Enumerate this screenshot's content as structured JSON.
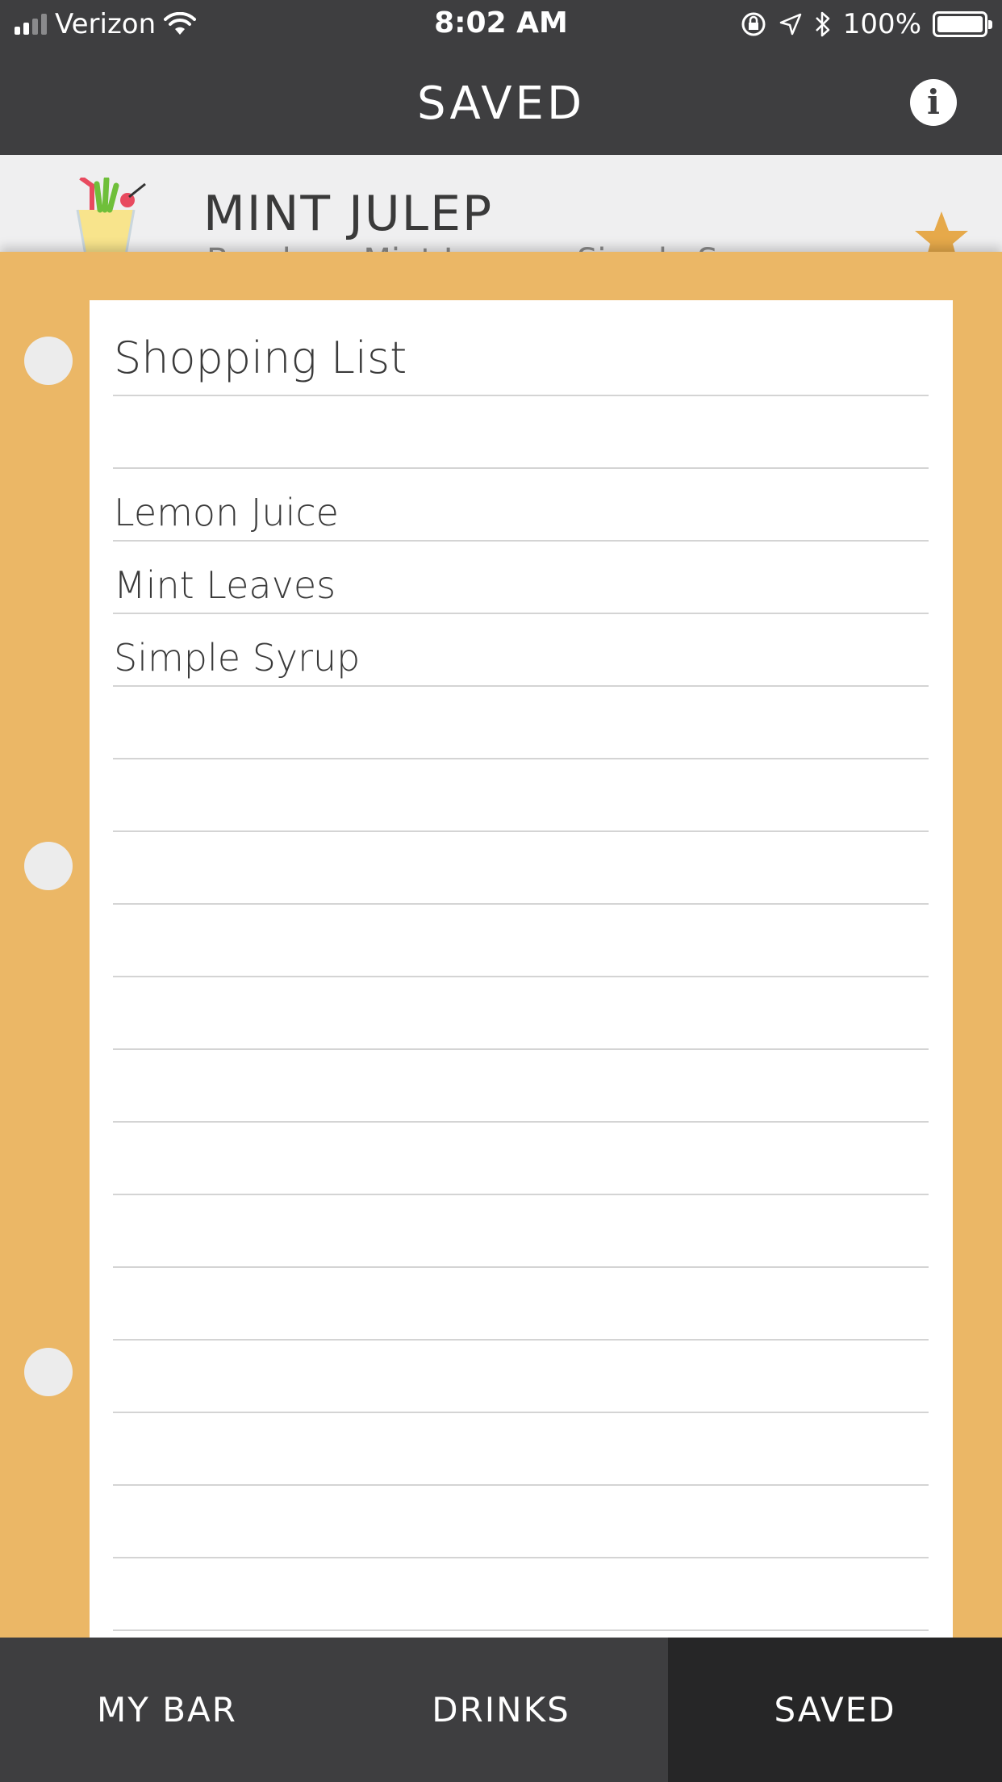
{
  "status_bar": {
    "carrier": "Verizon",
    "time": "8:02 AM",
    "battery": "100%"
  },
  "nav": {
    "title": "SAVED",
    "info_icon": "info-icon"
  },
  "saved_drink": {
    "name": "MINT JULEP",
    "ingredients": "Bourbon, Mint Leaves, Simple Syrup",
    "favorited": true,
    "star_color": "#e6a94a"
  },
  "shopping_list": {
    "title": "Shopping List",
    "items": [
      "Lemon Juice",
      "Mint Leaves",
      "Simple Syrup"
    ]
  },
  "tabs": [
    {
      "label": "MY BAR",
      "active": false
    },
    {
      "label": "DRINKS",
      "active": false
    },
    {
      "label": "SAVED",
      "active": true
    }
  ],
  "colors": {
    "bar_dark": "#3e3e40",
    "tab_active": "#262627",
    "notebook_orange": "#ebb766"
  }
}
